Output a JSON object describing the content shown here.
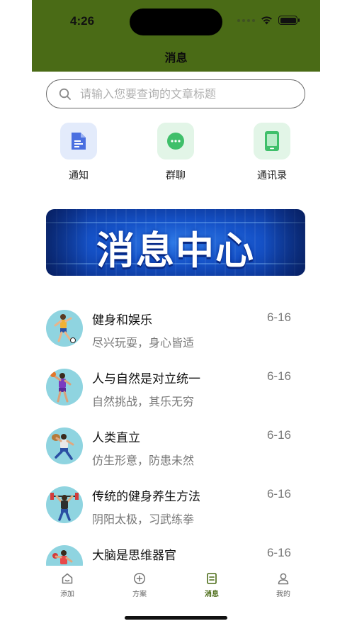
{
  "status": {
    "time": "4:26"
  },
  "header": {
    "title": "消息"
  },
  "search": {
    "placeholder": "请输入您要查询的文章标题"
  },
  "quick_actions": [
    {
      "label": "通知",
      "icon": "document-icon",
      "color": "#4a6fe0",
      "bg": "#e3ebfb"
    },
    {
      "label": "群聊",
      "icon": "chat-bubble-icon",
      "color": "#3fbf6a",
      "bg": "#e2f5e7"
    },
    {
      "label": "通讯录",
      "icon": "tablet-icon",
      "color": "#3fbf6a",
      "bg": "#e2f5e7"
    }
  ],
  "banner": {
    "title": "消息中心"
  },
  "messages": [
    {
      "title": "健身和娱乐",
      "subtitle": "尽兴玩耍，身心皆适",
      "date": "6-16"
    },
    {
      "title": "人与自然是对立统一",
      "subtitle": "自然挑战，其乐无穷",
      "date": "6-16"
    },
    {
      "title": "人类直立",
      "subtitle": "仿生形意，防患未然",
      "date": "6-16"
    },
    {
      "title": "传统的健身养生方法",
      "subtitle": "阴阳太极，习武练拳",
      "date": "6-16"
    },
    {
      "title": "大脑是思维器官",
      "subtitle": "",
      "date": "6-16"
    }
  ],
  "tabbar": {
    "items": [
      {
        "label": "添加",
        "icon": "home-icon",
        "active": false
      },
      {
        "label": "方案",
        "icon": "plus-circle-icon",
        "active": false
      },
      {
        "label": "消息",
        "icon": "message-doc-icon",
        "active": true
      },
      {
        "label": "我的",
        "icon": "user-icon",
        "active": false
      }
    ]
  },
  "colors": {
    "brand": "#4a6b16",
    "accent_blue": "#1552c8"
  }
}
